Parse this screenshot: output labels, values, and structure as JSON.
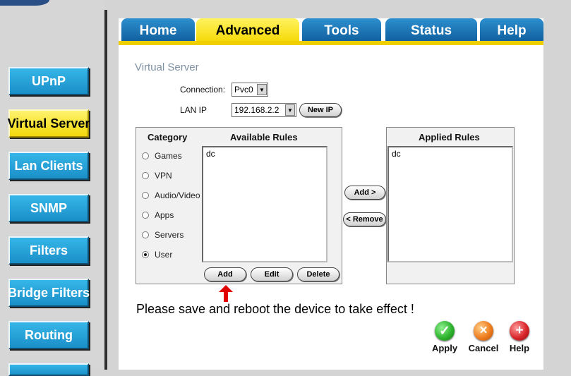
{
  "tabs": [
    {
      "label": "Home"
    },
    {
      "label": "Advanced"
    },
    {
      "label": "Tools"
    },
    {
      "label": "Status"
    },
    {
      "label": "Help"
    }
  ],
  "sidebar": {
    "items": [
      {
        "label": "UPnP"
      },
      {
        "label": "Virtual Server"
      },
      {
        "label": "Lan Clients"
      },
      {
        "label": "SNMP"
      },
      {
        "label": "Filters"
      },
      {
        "label": "Bridge Filters"
      },
      {
        "label": "Routing"
      }
    ]
  },
  "page": {
    "title": "Virtual Server",
    "connection_label": "Connection:",
    "connection_value": "Pvc0",
    "lanip_label": "LAN IP",
    "lanip_value": "192.168.2.2",
    "new_ip": "New IP",
    "category_header": "Category",
    "available_header": "Available Rules",
    "applied_header": "Applied Rules",
    "categories": [
      "Games",
      "VPN",
      "Audio/Video",
      "Apps",
      "Servers",
      "User"
    ],
    "selected_category": "User",
    "available_rules": [
      "dc"
    ],
    "applied_rules": [
      "dc"
    ],
    "add_rule": "Add >",
    "remove_rule": "< Remove",
    "add": "Add",
    "edit": "Edit",
    "delete": "Delete",
    "notice": "Please save and reboot the device to take effect !"
  },
  "actions": {
    "apply": "Apply",
    "cancel": "Cancel",
    "help": "Help"
  },
  "colors": {
    "tab_blue": "#0e5b99",
    "active_yellow": "#f5d700",
    "side_blue": "#1b8fc8",
    "apply_green": "#2fb52f",
    "cancel_orange": "#ef7d1f",
    "help_red": "#d9272b"
  }
}
